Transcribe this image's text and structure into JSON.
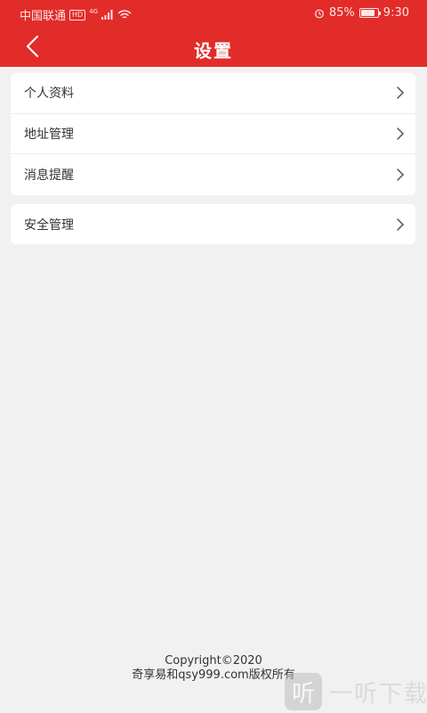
{
  "status_bar": {
    "carrier": "中国联通",
    "hd": "HD",
    "network": "4G",
    "battery_percent": "85%",
    "battery_level": 0.85,
    "time": "9:30"
  },
  "header": {
    "title": "设置",
    "back_icon": "chevron-left-icon"
  },
  "settings_groups": [
    {
      "items": [
        {
          "label": "个人资料"
        },
        {
          "label": "地址管理"
        },
        {
          "label": "消息提醒"
        }
      ]
    },
    {
      "items": [
        {
          "label": "安全管理"
        }
      ]
    }
  ],
  "footer": {
    "copyright": "Copyright©2020",
    "owner": "奇享易和qsy999.com版权所有"
  },
  "watermark": {
    "logo_char": "听",
    "text": "一听下载"
  },
  "colors": {
    "header_bg": "#e22c2a",
    "page_bg": "#f1f1f1",
    "card_bg": "#ffffff"
  }
}
